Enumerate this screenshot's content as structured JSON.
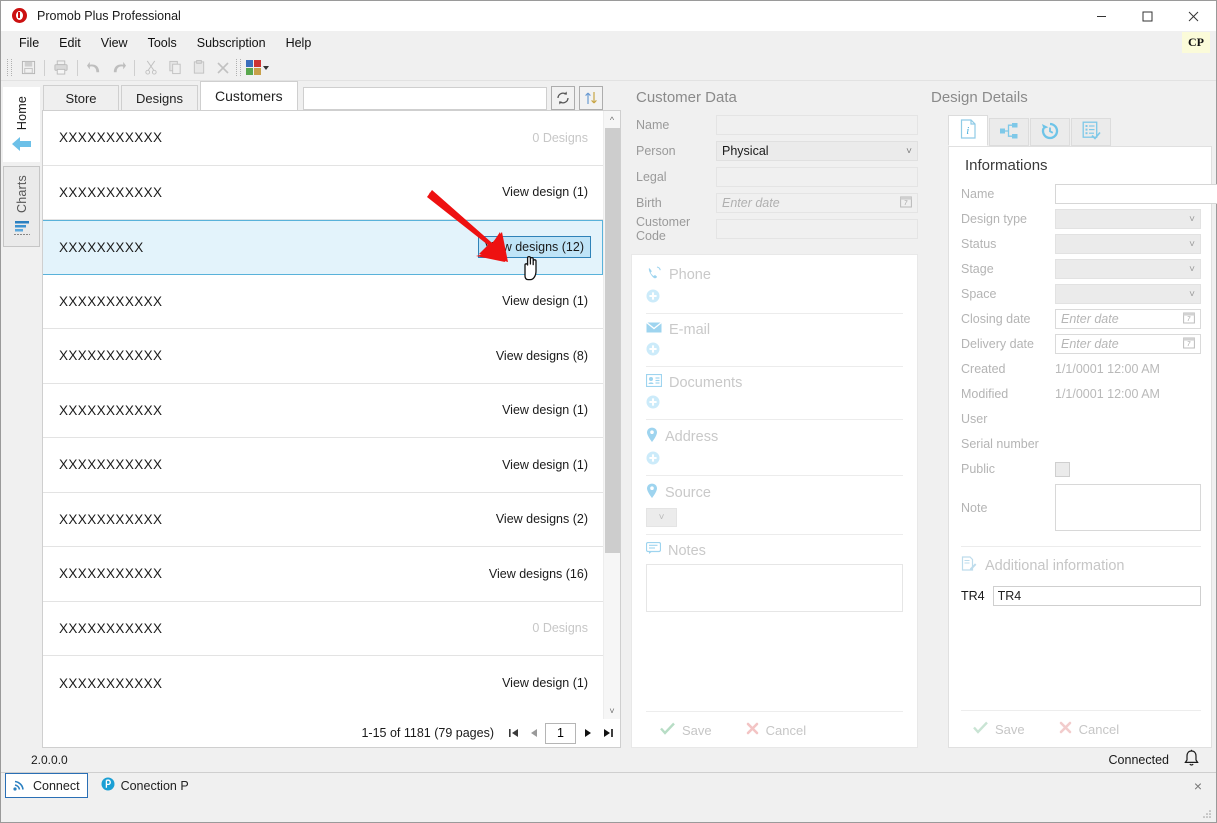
{
  "window": {
    "title": "Promob Plus Professional",
    "app_icon": "promob-logo-icon",
    "minimize": "─",
    "maximize": "□",
    "close": "×"
  },
  "menu": {
    "items": [
      "File",
      "Edit",
      "View",
      "Tools",
      "Subscription",
      "Help"
    ],
    "user_badge": "CP"
  },
  "toolbar": {
    "buttons": [
      "save-icon",
      "print-icon",
      "undo-icon",
      "redo-icon",
      "cut-icon",
      "copy-icon",
      "paste-icon",
      "delete-icon",
      "color-palette-icon"
    ]
  },
  "side_tabs": [
    {
      "label": "Home",
      "icon": "home-arrow-icon",
      "active": true
    },
    {
      "label": "Charts",
      "icon": "bar-chart-icon",
      "active": false
    }
  ],
  "list_panel": {
    "tabs": [
      {
        "label": "Store",
        "active": false
      },
      {
        "label": "Designs",
        "active": false
      },
      {
        "label": "Customers",
        "active": true
      }
    ],
    "search": {
      "value": "",
      "placeholder": ""
    },
    "refresh_icon": "refresh-icon",
    "sort_icon": "sort-updown-icon",
    "rows": [
      {
        "name": "XXXXXXXXXXX",
        "link": "0 Designs",
        "dim": true,
        "selected": false
      },
      {
        "name": "XXXXXXXXXXX",
        "link": "View design (1)",
        "dim": false,
        "selected": false
      },
      {
        "name": "XXXXXXXXX",
        "link": "View designs (12)",
        "dim": false,
        "selected": true
      },
      {
        "name": "XXXXXXXXXXX",
        "link": "View design (1)",
        "dim": false,
        "selected": false
      },
      {
        "name": "XXXXXXXXXXX",
        "link": "View designs (8)",
        "dim": false,
        "selected": false
      },
      {
        "name": "XXXXXXXXXXX",
        "link": "View design (1)",
        "dim": false,
        "selected": false
      },
      {
        "name": "XXXXXXXXXXX",
        "link": "View design (1)",
        "dim": false,
        "selected": false
      },
      {
        "name": "XXXXXXXXXXX",
        "link": "View designs (2)",
        "dim": false,
        "selected": false
      },
      {
        "name": "XXXXXXXXXXX",
        "link": "View designs (16)",
        "dim": false,
        "selected": false
      },
      {
        "name": "XXXXXXXXXXX",
        "link": "0 Designs",
        "dim": true,
        "selected": false
      },
      {
        "name": "XXXXXXXXXXX",
        "link": "View design (1)",
        "dim": false,
        "selected": false
      }
    ],
    "pager": {
      "summary": "1-15 of 1181 (79 pages)",
      "first": "first-page-icon",
      "prev": "prev-page-icon",
      "page_value": "1",
      "next": "next-page-icon",
      "last": "last-page-icon"
    }
  },
  "customer_data": {
    "title": "Customer Data",
    "fields": [
      {
        "label": "Name",
        "type": "text",
        "value": ""
      },
      {
        "label": "Person",
        "type": "select",
        "value": "Physical"
      },
      {
        "label": "Legal",
        "type": "text",
        "value": ""
      },
      {
        "label": "Birth",
        "type": "date",
        "value": "Enter date"
      },
      {
        "label": "Customer Code",
        "type": "text",
        "value": ""
      }
    ],
    "sections": [
      {
        "label": "Phone",
        "icon": "phone-icon",
        "add": true
      },
      {
        "label": "E-mail",
        "icon": "envelope-icon",
        "add": true
      },
      {
        "label": "Documents",
        "icon": "id-card-icon",
        "add": true
      },
      {
        "label": "Address",
        "icon": "map-pin-icon",
        "add": true
      },
      {
        "label": "Source",
        "icon": "map-pin-icon",
        "add": false
      },
      {
        "label": "Notes",
        "icon": "note-bubble-icon",
        "add": false
      }
    ],
    "source_value": "",
    "notes_value": "",
    "save_label": "Save",
    "cancel_label": "Cancel"
  },
  "design_details": {
    "title": "Design Details",
    "tabs": [
      {
        "icon": "info-document-icon",
        "active": true
      },
      {
        "icon": "hierarchy-tree-icon",
        "active": false
      },
      {
        "icon": "history-clock-icon",
        "active": false
      },
      {
        "icon": "checklist-icon",
        "active": false
      }
    ],
    "heading": "Informations",
    "fields": [
      {
        "label": "Name",
        "type": "text",
        "value": ""
      },
      {
        "label": "Design type",
        "type": "select",
        "value": ""
      },
      {
        "label": "Status",
        "type": "select",
        "value": ""
      },
      {
        "label": "Stage",
        "type": "select",
        "value": ""
      },
      {
        "label": "Space",
        "type": "select",
        "value": ""
      },
      {
        "label": "Closing date",
        "type": "date",
        "value": "Enter date"
      },
      {
        "label": "Delivery date",
        "type": "date",
        "value": "Enter date"
      },
      {
        "label": "Created",
        "type": "readonly",
        "value": "1/1/0001 12:00 AM"
      },
      {
        "label": "Modified",
        "type": "readonly",
        "value": "1/1/0001 12:00 AM"
      },
      {
        "label": "User",
        "type": "readonly",
        "value": ""
      },
      {
        "label": "Serial number",
        "type": "readonly",
        "value": ""
      },
      {
        "label": "Public",
        "type": "checkbox",
        "value": ""
      },
      {
        "label": "Note",
        "type": "textarea",
        "value": ""
      }
    ],
    "additional": {
      "heading": "Additional information",
      "icon": "edit-document-icon",
      "field_label": "TR4",
      "field_value": "TR4"
    },
    "save_label": "Save",
    "cancel_label": "Cancel"
  },
  "status": {
    "version": "2.0.0.0",
    "connection": "Connected",
    "bell_icon": "bell-icon"
  },
  "taskbar": {
    "items": [
      {
        "label": "Connect",
        "icon": "wifi-icon",
        "active": true
      },
      {
        "label": "Conection P",
        "icon": "promob-circle-icon",
        "active": false
      }
    ],
    "close_label": "×"
  },
  "colors": {
    "accent": "#2f82b8",
    "selection_bg": "#e3f3fb",
    "annotation_arrow": "#ee1111",
    "logo_red": "#cc1111",
    "icon_blue": "#9ed4ef"
  }
}
